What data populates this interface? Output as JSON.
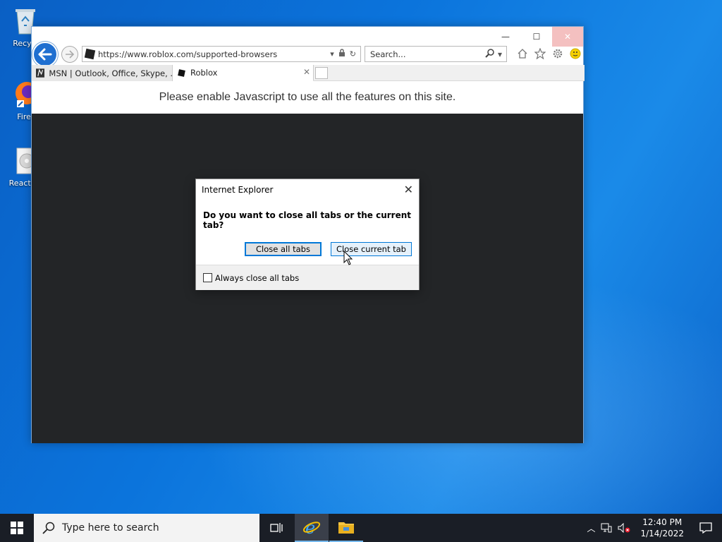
{
  "desktop": {
    "icons": [
      {
        "label": "Recycl"
      },
      {
        "label": "Firef"
      },
      {
        "label": "ReactOS"
      }
    ]
  },
  "browser": {
    "address": "https://www.roblox.com/supported-browsers",
    "search_placeholder": "Search...",
    "tabs": [
      {
        "label": "MSN | Outlook, Office, Skype, ..."
      },
      {
        "label": "Roblox"
      }
    ],
    "notice": "Please enable Javascript to use all the features on this site."
  },
  "dialog": {
    "title": "Internet Explorer",
    "message": "Do you want to close all tabs or the current tab?",
    "close_all_label": "Close all tabs",
    "close_current_label": "Close current tab",
    "checkbox_label": "Always close all tabs",
    "checkbox_checked": false
  },
  "taskbar": {
    "search_placeholder": "Type here to search",
    "time": "12:40 PM",
    "date": "1/14/2022"
  },
  "colors": {
    "accent": "#0078d7",
    "page_dark": "#232527",
    "taskbar": "#1a1e26"
  }
}
